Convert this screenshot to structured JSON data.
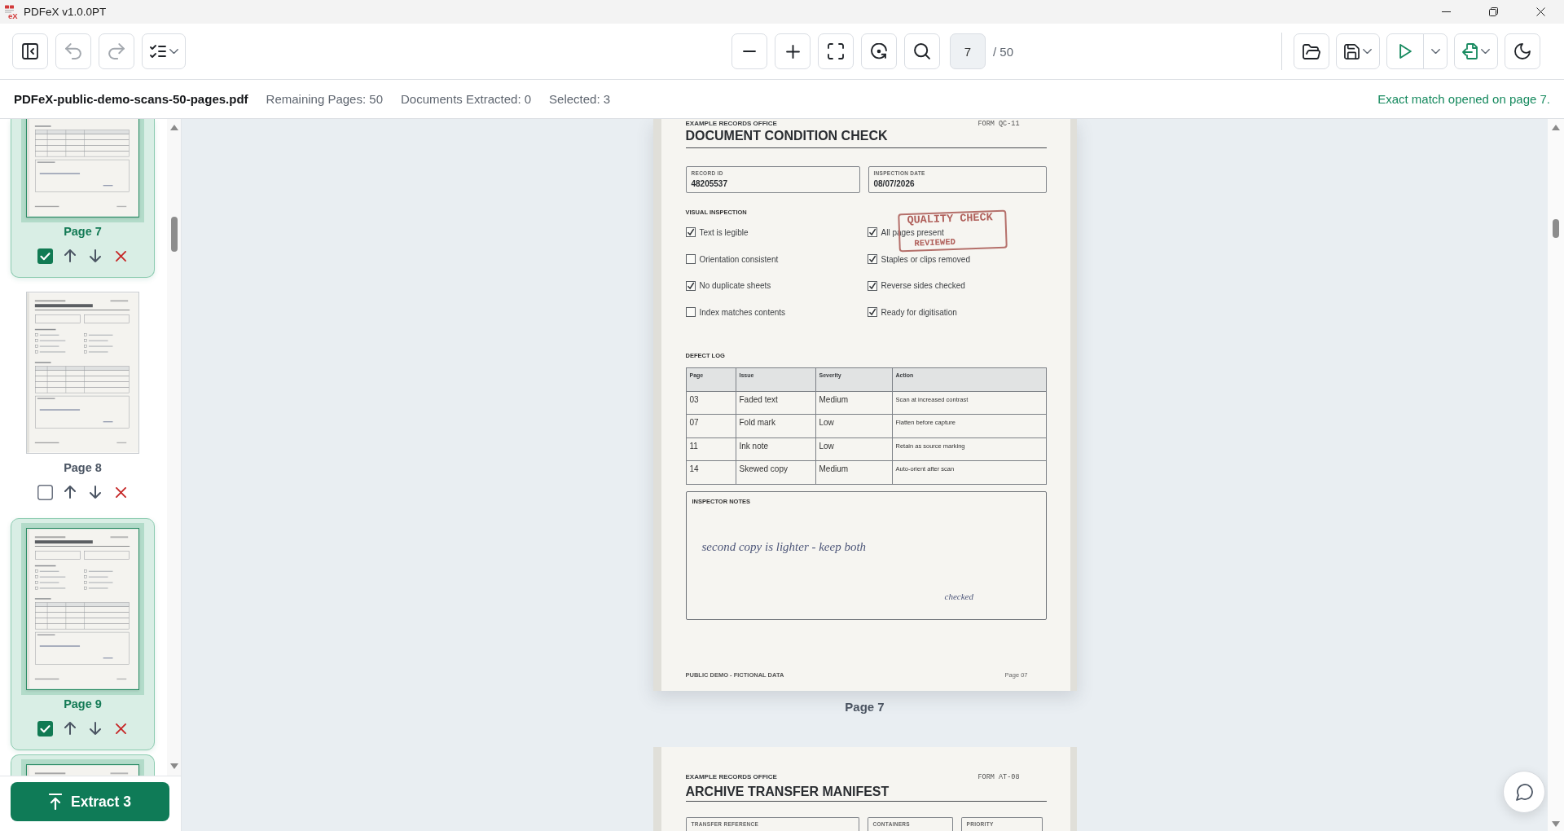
{
  "app": {
    "logo_text": "eX",
    "title": "PDFeX v1.0.0PT"
  },
  "toolbar": {
    "undo": {
      "disabled": true
    },
    "redo": {
      "disabled": true
    },
    "page_input": {
      "value": "7"
    },
    "page_total": "/ 50"
  },
  "info_bar": {
    "file_name": "PDFeX-public-demo-scans-50-pages.pdf",
    "stats": [
      "Remaining Pages: 50",
      "Documents Extracted: 0",
      "Selected: 3"
    ],
    "message": "Exact match opened on page 7."
  },
  "sidebar": {
    "pages": [
      {
        "label": "Page 7",
        "selected": true
      },
      {
        "label": "Page 8",
        "selected": false
      },
      {
        "label": "Page 9",
        "selected": true
      },
      {
        "selected": true
      }
    ],
    "extract_button": "Extract 3"
  },
  "viewer": {
    "pages": [
      {
        "office": "EXAMPLE RECORDS OFFICE",
        "form_code": "FORM QC-11",
        "title": "DOCUMENT CONDITION CHECK",
        "fields": [
          {
            "label": "RECORD ID",
            "value": "48205537"
          },
          {
            "label": "INSPECTION DATE",
            "value": "08/07/2026"
          }
        ],
        "checklist": {
          "heading": "VISUAL INSPECTION",
          "items": [
            {
              "label": "Text is legible",
              "checked": true
            },
            {
              "label": "All pages present",
              "checked": true
            },
            {
              "label": "Orientation consistent",
              "checked": false
            },
            {
              "label": "Staples or clips removed",
              "checked": true
            },
            {
              "label": "No duplicate sheets",
              "checked": true
            },
            {
              "label": "Reverse sides checked",
              "checked": true
            },
            {
              "label": "Index matches contents",
              "checked": false
            },
            {
              "label": "Ready for digitisation",
              "checked": true
            }
          ]
        },
        "stamp": {
          "lines": [
            "QUALITY CHECK",
            "REVIEWED"
          ]
        },
        "defect_log": {
          "heading": "DEFECT LOG",
          "columns": [
            "Page",
            "Issue",
            "Severity",
            "Action"
          ],
          "rows": [
            [
              "03",
              "Faded text",
              "Medium",
              "Scan at increased contrast"
            ],
            [
              "07",
              "Fold mark",
              "Low",
              "Flatten before capture"
            ],
            [
              "11",
              "Ink note",
              "Low",
              "Retain as source marking"
            ],
            [
              "14",
              "Skewed copy",
              "Medium",
              "Auto-orient after scan"
            ]
          ]
        },
        "notes": {
          "heading": "INSPECTOR NOTES",
          "handwriting": "second copy is lighter - keep both",
          "mark": "checked"
        },
        "footer": {
          "left": "PUBLIC DEMO - FICTIONAL DATA",
          "right": "Page 07"
        },
        "caption": "Page 7"
      },
      {
        "office": "EXAMPLE RECORDS OFFICE",
        "form_code": "FORM AT-08",
        "title": "ARCHIVE TRANSFER MANIFEST",
        "fields": [
          {
            "label": "TRANSFER REFERENCE"
          },
          {
            "label": "CONTAINERS"
          },
          {
            "label": "PRIORITY"
          }
        ]
      }
    ]
  }
}
